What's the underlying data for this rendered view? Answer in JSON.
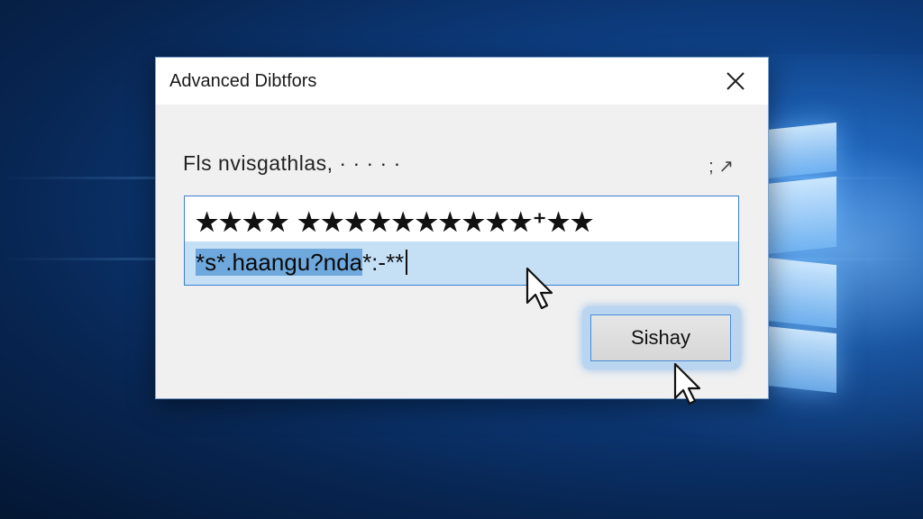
{
  "dialog": {
    "title": "Advanced Dibtfors",
    "close_glyph": "✕",
    "prompt": "Fls nvisgathlas, · · · · ·",
    "hint": "; ↗",
    "textbox": {
      "line1": "★★★★ ★★★★★★★★★★⁺★★",
      "line2_selected": "*s*.haangu?nda",
      "line2_rest": "*:-**"
    },
    "action_button": "Sishay"
  },
  "colors": {
    "accent": "#3a7fd0",
    "selection": "#6fa8dc",
    "selection_line": "#c5dff5"
  }
}
